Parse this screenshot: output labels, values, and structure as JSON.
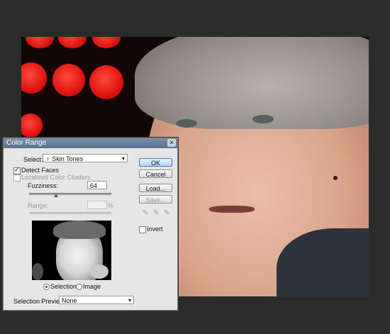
{
  "dialog": {
    "title": "Color Range",
    "select_label": "Select:",
    "select_value": "Skin Tones",
    "detect_faces_label": "Detect Faces",
    "detect_faces_checked": true,
    "localized_label": "Localized Color Clusters",
    "localized_checked": false,
    "fuzziness_label": "Fuzziness:",
    "fuzziness_value": "64",
    "range_label": "Range:",
    "range_value": "",
    "range_unit": "%",
    "buttons": {
      "ok": "OK",
      "cancel": "Cancel",
      "load": "Load...",
      "save": "Save..."
    },
    "invert_label": "Invert",
    "radio_selection": "Selection",
    "radio_image": "Image",
    "selection_preview_label": "Selection Preview:",
    "selection_preview_value": "None"
  },
  "icons": {
    "close": "close-icon",
    "dropdown": "chevron-down-icon",
    "eyedropper": "eyedropper-icon",
    "skin_tone": "person-icon"
  }
}
